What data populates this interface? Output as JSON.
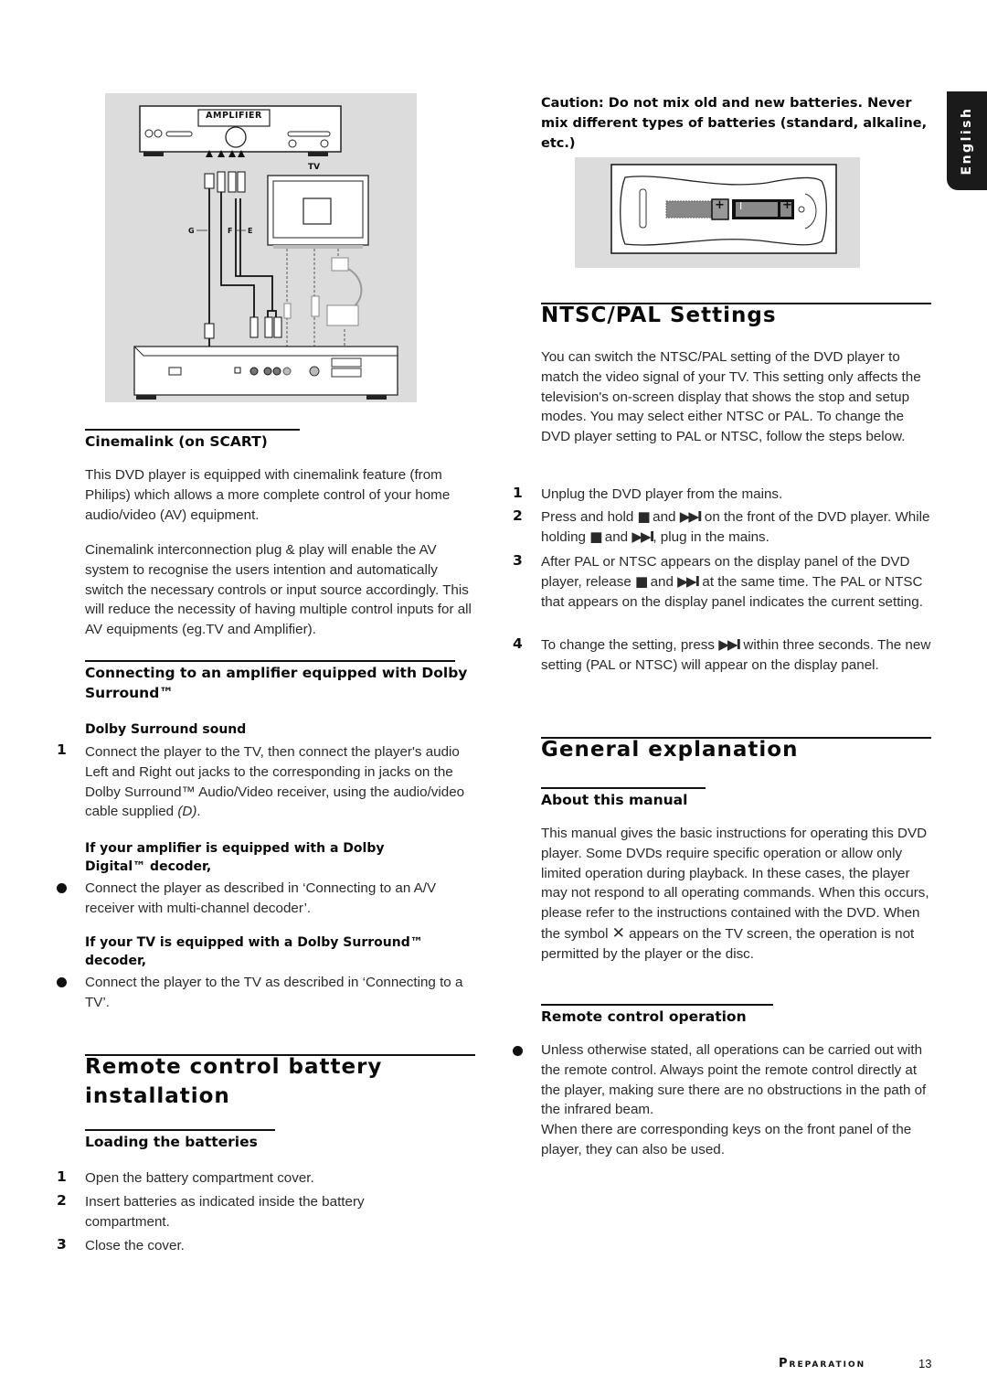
{
  "language_tab": "English",
  "connection_diagram": {
    "amplifier_label": "AMPLIFIER",
    "tv_label": "TV",
    "cable_labels": [
      "G",
      "F",
      "E"
    ]
  },
  "left_column": {
    "cinemalink": {
      "heading": "Cinemalink (on SCART)",
      "paragraphs": [
        "This DVD player is equipped with cinemalink feature (from Philips) which allows a more complete control of your home audio/video (AV) equipment.",
        "Cinemalink interconnection plug & play will enable the AV system to recognise the users intention and automatically switch the necessary controls or input source accordingly. This will reduce the necessity of having multiple control inputs for all AV equipments (eg.TV and Amplifier)."
      ]
    },
    "amplifier_dolby": {
      "heading": "Connecting to an amplifier equipped with Dolby Surround™",
      "subheading": "Dolby Surround sound",
      "step_number": "1",
      "step_text": "Connect the player to the TV, then connect the player's audio Left  and Right out jacks to the corresponding in jacks on the Dolby Surround™ Audio/Video receiver, using the audio/video cable supplied ",
      "step_ref": "(D)",
      "step_end": ".",
      "digital_heading": "If your amplifier is equipped with a Dolby Digital™ decoder,",
      "digital_bullet": "Connect the player as described in ‘Connecting to an A/V receiver with multi-channel decoder’.",
      "tv_heading": "If your TV is equipped with a Dolby Surround™ decoder,",
      "tv_bullet": "Connect the player to the TV as described in ‘Connecting to a TV’."
    },
    "battery_installation": {
      "heading_line1": "Remote control battery",
      "heading_line2": "installation",
      "subheading": "Loading the batteries",
      "steps": [
        {
          "num": "1",
          "text": "Open the battery compartment cover."
        },
        {
          "num": "2",
          "text": "Insert batteries as indicated inside the battery compartment."
        },
        {
          "num": "3",
          "text": "Close the cover."
        }
      ]
    }
  },
  "right_column": {
    "caution": "Caution: Do not mix old and new batteries. Never mix different types of batteries (standard, alkaline, etc.)",
    "battery_figure": {
      "polarity_plus": "+",
      "polarity_minus": "I"
    },
    "ntsc_pal": {
      "heading": "NTSC/PAL Settings",
      "intro": "You can switch the NTSC/PAL setting of the DVD player to match the video signal of your TV. This setting only affects the television's on-screen display that shows the stop and setup modes. You may select either NTSC or PAL. To change the DVD player setting to PAL or NTSC, follow the steps below.",
      "stop_symbol": "■",
      "next_symbol": "▶▶I",
      "steps": [
        {
          "num": "1",
          "parts": [
            "Unplug the DVD player from the mains."
          ]
        },
        {
          "num": "2",
          "parts": [
            "Press and hold ",
            "■",
            " and ",
            "▶▶I",
            " on the front of the DVD player. While holding ",
            "■",
            " and ",
            "▶▶I",
            ", plug in the mains."
          ]
        },
        {
          "num": "3",
          "parts": [
            "After PAL or NTSC appears on the display panel of the DVD player, release ",
            "■",
            " and ",
            "▶▶I",
            " at the same time. The PAL or NTSC that appears on the display panel indicates the current setting."
          ]
        },
        {
          "num": "4",
          "parts": [
            "To change the setting, press ",
            "▶▶I",
            " within three seconds. The new setting (PAL or NTSC) will appear on the display panel."
          ]
        }
      ]
    },
    "general": {
      "heading": "General explanation",
      "about_heading": "About this manual",
      "about_text_before": "This manual gives the basic instructions for operating this DVD player. Some DVDs require specific operation or allow only limited operation during playback. In these cases, the player may not respond to all operating commands. When this occurs, please refer to the instructions contained with the DVD.  When the symbol ",
      "about_symbol": "✕",
      "about_text_after": " appears on the TV screen, the operation is not permitted by the player or the disc.",
      "remote_heading": "Remote control operation",
      "remote_bullet_p1": "Unless otherwise stated, all operations can be carried out with the remote control. Always point the remote control directly at the player, making sure there are no obstructions in the path of the infrared beam.",
      "remote_bullet_p2": "When there are corresponding keys on the front panel of the player, they can also be used."
    }
  },
  "footer": {
    "section": "Preparation",
    "page_number": "13"
  }
}
